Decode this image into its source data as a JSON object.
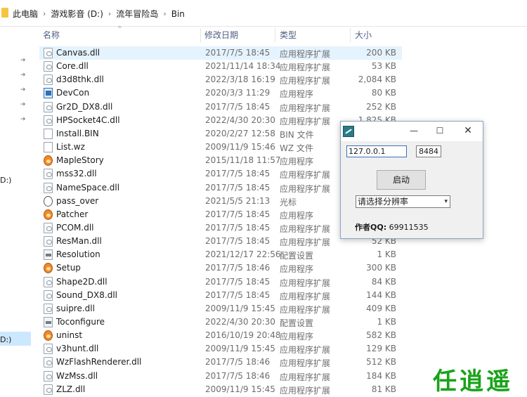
{
  "breadcrumb": [
    "此电脑",
    "游戏影音 (D:)",
    "流年冒险岛",
    "Bin"
  ],
  "nav": {
    "drive_label_1": "D:)",
    "drive_label_2": "D:)"
  },
  "columns": {
    "name": "名称",
    "date": "修改日期",
    "type": "类型",
    "size": "大小"
  },
  "files": [
    {
      "name": "Canvas.dll",
      "date": "2017/7/5 18:45",
      "type": "应用程序扩展",
      "size": "200 KB",
      "icon": "dll-file-icon"
    },
    {
      "name": "Core.dll",
      "date": "2021/11/14 18:34",
      "type": "应用程序扩展",
      "size": "53 KB",
      "icon": "dll-file-icon"
    },
    {
      "name": "d3d8thk.dll",
      "date": "2022/3/18 16:19",
      "type": "应用程序扩展",
      "size": "2,084 KB",
      "icon": "dll-file-icon"
    },
    {
      "name": "DevCon",
      "date": "2020/3/3 11:29",
      "type": "应用程序",
      "size": "80 KB",
      "icon": "exe-window-icon"
    },
    {
      "name": "Gr2D_DX8.dll",
      "date": "2017/7/5 18:45",
      "type": "应用程序扩展",
      "size": "252 KB",
      "icon": "dll-file-icon"
    },
    {
      "name": "HPSocket4C.dll",
      "date": "2022/4/30 20:30",
      "type": "应用程序扩展",
      "size": "1,825 KB",
      "icon": "dll-file-icon"
    },
    {
      "name": "Install.BIN",
      "date": "2020/2/27 12:58",
      "type": "BIN 文件",
      "size": "",
      "icon": "blank-file-icon"
    },
    {
      "name": "List.wz",
      "date": "2009/11/9 15:46",
      "type": "WZ 文件",
      "size": "",
      "icon": "blank-file-icon"
    },
    {
      "name": "MapleStory",
      "date": "2015/11/18 11:57",
      "type": "应用程序",
      "size": "",
      "icon": "maplestory-icon"
    },
    {
      "name": "mss32.dll",
      "date": "2017/7/5 18:45",
      "type": "应用程序扩展",
      "size": "",
      "icon": "dll-file-icon"
    },
    {
      "name": "NameSpace.dll",
      "date": "2017/7/5 18:45",
      "type": "应用程序扩展",
      "size": "",
      "icon": "dll-file-icon"
    },
    {
      "name": "pass_over",
      "date": "2021/5/5 21:13",
      "type": "光标",
      "size": "",
      "icon": "cursor-icon"
    },
    {
      "name": "Patcher",
      "date": "2017/7/5 18:45",
      "type": "应用程序",
      "size": "",
      "icon": "maplestory-icon"
    },
    {
      "name": "PCOM.dll",
      "date": "2017/7/5 18:45",
      "type": "应用程序扩展",
      "size": "",
      "icon": "dll-file-icon"
    },
    {
      "name": "ResMan.dll",
      "date": "2017/7/5 18:45",
      "type": "应用程序扩展",
      "size": "52 KB",
      "icon": "dll-file-icon"
    },
    {
      "name": "Resolution",
      "date": "2021/12/17 22:56",
      "type": "配置设置",
      "size": "1 KB",
      "icon": "config-file-icon"
    },
    {
      "name": "Setup",
      "date": "2017/7/5 18:46",
      "type": "应用程序",
      "size": "300 KB",
      "icon": "maplestory-icon"
    },
    {
      "name": "Shape2D.dll",
      "date": "2017/7/5 18:45",
      "type": "应用程序扩展",
      "size": "84 KB",
      "icon": "dll-file-icon"
    },
    {
      "name": "Sound_DX8.dll",
      "date": "2017/7/5 18:45",
      "type": "应用程序扩展",
      "size": "144 KB",
      "icon": "dll-file-icon"
    },
    {
      "name": "suipre.dll",
      "date": "2009/11/9 15:45",
      "type": "应用程序扩展",
      "size": "409 KB",
      "icon": "dll-file-icon"
    },
    {
      "name": "Toconfigure",
      "date": "2022/4/30 20:30",
      "type": "配置设置",
      "size": "1 KB",
      "icon": "config-file-icon"
    },
    {
      "name": "uninst",
      "date": "2016/10/19 20:48",
      "type": "应用程序",
      "size": "582 KB",
      "icon": "maplestory-icon"
    },
    {
      "name": "v3hunt.dll",
      "date": "2009/11/9 15:45",
      "type": "应用程序扩展",
      "size": "129 KB",
      "icon": "dll-file-icon"
    },
    {
      "name": "WzFlashRenderer.dll",
      "date": "2017/7/5 18:46",
      "type": "应用程序扩展",
      "size": "512 KB",
      "icon": "dll-file-icon"
    },
    {
      "name": "WzMss.dll",
      "date": "2017/7/5 18:46",
      "type": "应用程序扩展",
      "size": "184 KB",
      "icon": "dll-file-icon"
    },
    {
      "name": "ZLZ.dll",
      "date": "2009/11/9 15:45",
      "type": "应用程序扩展",
      "size": "81 KB",
      "icon": "dll-file-icon"
    }
  ],
  "dialog": {
    "ip_value": "127.0.0.1",
    "port_value": "8484",
    "start_label": "启动",
    "resolution_placeholder": "请选择分辨率",
    "author_label": "作者QQ:",
    "author_qq": "69911535"
  },
  "watermark": {
    "text": "任逍遥"
  },
  "colors": {
    "selection": "#e5f3ff",
    "header_text": "#4d6082",
    "watermark": "#19a319"
  }
}
